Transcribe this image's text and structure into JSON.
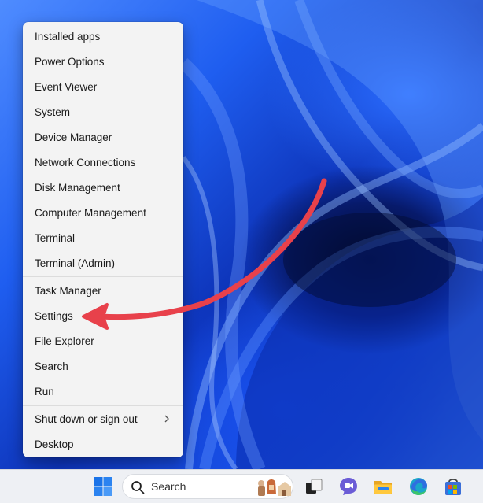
{
  "menu": {
    "items": [
      {
        "label": "Installed apps"
      },
      {
        "label": "Power Options"
      },
      {
        "label": "Event Viewer"
      },
      {
        "label": "System"
      },
      {
        "label": "Device Manager"
      },
      {
        "label": "Network Connections"
      },
      {
        "label": "Disk Management"
      },
      {
        "label": "Computer Management"
      },
      {
        "label": "Terminal"
      },
      {
        "label": "Terminal (Admin)"
      },
      {
        "label": "Task Manager"
      },
      {
        "label": "Settings"
      },
      {
        "label": "File Explorer"
      },
      {
        "label": "Search"
      },
      {
        "label": "Run"
      },
      {
        "label": "Shut down or sign out"
      },
      {
        "label": "Desktop"
      }
    ]
  },
  "taskbar": {
    "search_label": "Search",
    "icons": [
      "windows-start-icon",
      "search-icon",
      "task-view-icon",
      "teams-chat-icon",
      "file-explorer-icon",
      "edge-browser-icon",
      "microsoft-store-icon"
    ]
  },
  "colors": {
    "arrow": "#e8414b",
    "menu_bg": "#f3f3f3",
    "taskbar_bg": "#eef0f4",
    "wallpaper_blue": "#1f5ef0"
  }
}
